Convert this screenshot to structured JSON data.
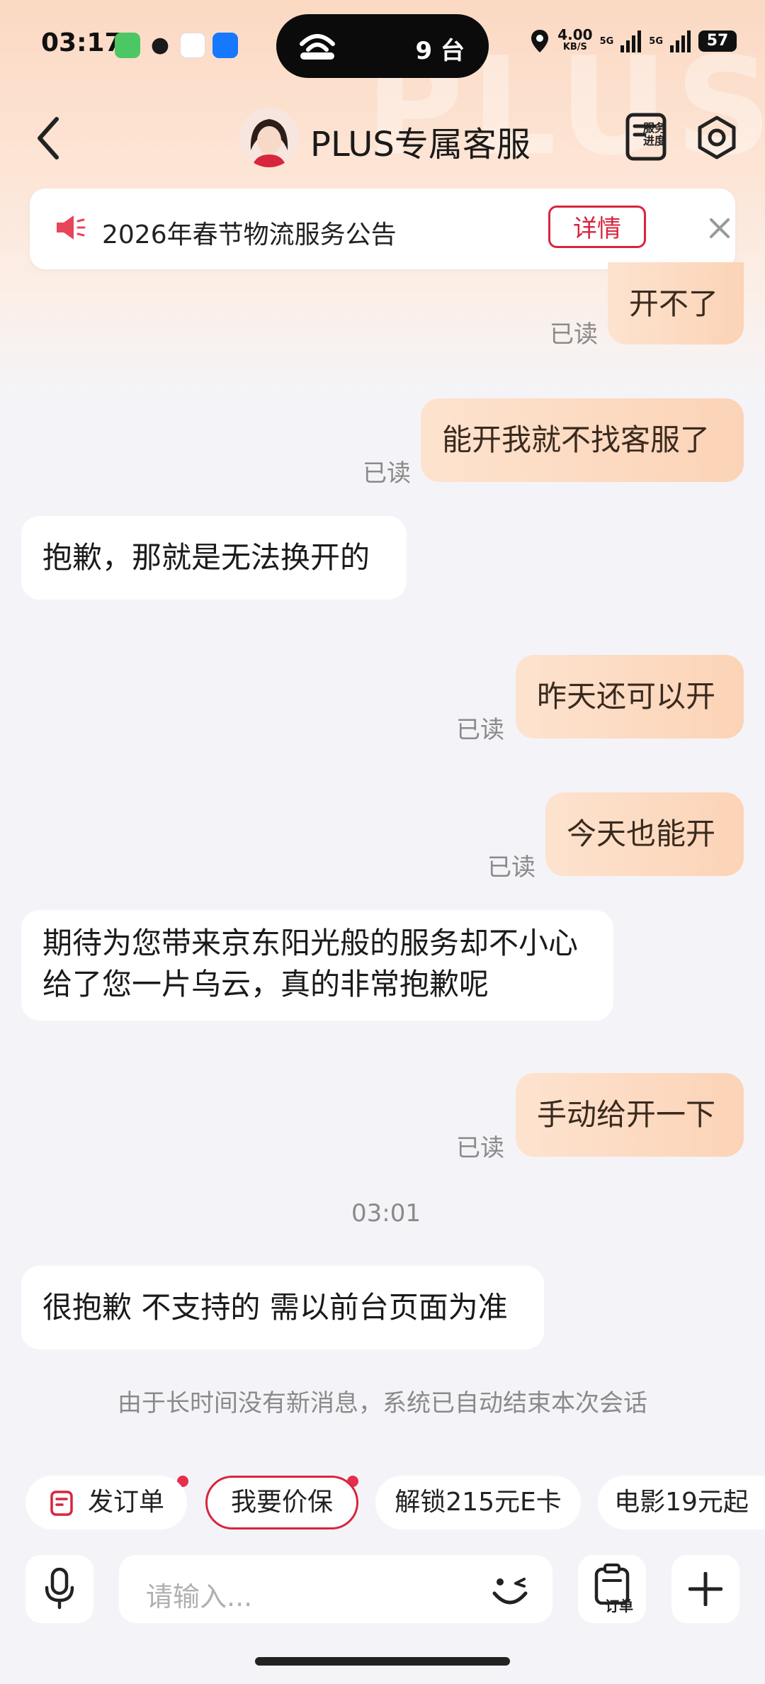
{
  "status_bar": {
    "time": "03:17",
    "island_count": "9 台",
    "net_speed": "4.00",
    "net_unit": "KB/S",
    "sig1": "5G",
    "sig2": "5G",
    "battery": "57"
  },
  "header": {
    "title": "PLUS专属客服",
    "progress_label": "服务进度"
  },
  "notice": {
    "text": "2026年春节物流服务公告",
    "detail_label": "详情"
  },
  "messages": [
    {
      "side": "out",
      "text": "开不了",
      "status": "已读"
    },
    {
      "side": "out",
      "text": "能开我就不找客服了",
      "status": "已读"
    },
    {
      "side": "in",
      "text": "抱歉，那就是无法换开的"
    },
    {
      "side": "out",
      "text": "昨天还可以开",
      "status": "已读"
    },
    {
      "side": "out",
      "text": "今天也能开",
      "status": "已读"
    },
    {
      "side": "in",
      "text": "期待为您带来京东阳光般的服务却不小心给了您一片乌云，真的非常抱歉呢"
    },
    {
      "side": "out",
      "text": "手动给开一下",
      "status": "已读"
    },
    {
      "side": "in",
      "text": "很抱歉 不支持的 需以前台页面为准"
    }
  ],
  "timestamp": "03:01",
  "system_message": "由于长时间没有新消息，系统已自动结束本次会话",
  "quick_actions": [
    "发订单",
    "我要价保",
    "解锁215元E卡",
    "电影19元起"
  ],
  "input": {
    "placeholder": "请输入...",
    "order_label": "订单"
  }
}
